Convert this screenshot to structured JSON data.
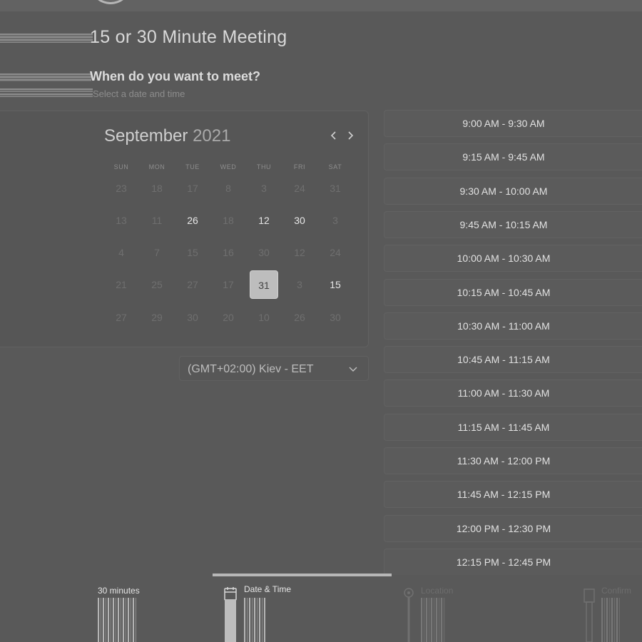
{
  "header": {
    "meeting_title": "15 or 30 Minute Meeting",
    "question": "When do you want to meet?",
    "subtitle": "Select a date and time"
  },
  "calendar": {
    "month": "September",
    "year": "2021",
    "prev_icon": "chevron-left-icon",
    "next_icon": "chevron-right-icon",
    "weekdays": [
      "SUN",
      "MON",
      "TUE",
      "WED",
      "THU",
      "FRI",
      "SAT"
    ],
    "weeks": [
      [
        {
          "d": "23",
          "a": false
        },
        {
          "d": "18",
          "a": false
        },
        {
          "d": "17",
          "a": false
        },
        {
          "d": "8",
          "a": false
        },
        {
          "d": "3",
          "a": false
        },
        {
          "d": "24",
          "a": false
        },
        {
          "d": "31",
          "a": false
        }
      ],
      [
        {
          "d": "13",
          "a": false
        },
        {
          "d": "11",
          "a": false
        },
        {
          "d": "26",
          "a": true
        },
        {
          "d": "18",
          "a": false
        },
        {
          "d": "12",
          "a": true
        },
        {
          "d": "30",
          "a": true
        },
        {
          "d": "3",
          "a": false
        }
      ],
      [
        {
          "d": "4",
          "a": false
        },
        {
          "d": "7",
          "a": false
        },
        {
          "d": "15",
          "a": false
        },
        {
          "d": "16",
          "a": false
        },
        {
          "d": "30",
          "a": false
        },
        {
          "d": "12",
          "a": false
        },
        {
          "d": "24",
          "a": false
        }
      ],
      [
        {
          "d": "21",
          "a": false
        },
        {
          "d": "25",
          "a": false
        },
        {
          "d": "27",
          "a": false
        },
        {
          "d": "17",
          "a": false
        },
        {
          "d": "31",
          "a": true,
          "selected": true
        },
        {
          "d": "3",
          "a": false
        },
        {
          "d": "15",
          "a": true
        }
      ],
      [
        {
          "d": "27",
          "a": false
        },
        {
          "d": "29",
          "a": false
        },
        {
          "d": "30",
          "a": false
        },
        {
          "d": "20",
          "a": false
        },
        {
          "d": "10",
          "a": false
        },
        {
          "d": "26",
          "a": false
        },
        {
          "d": "30",
          "a": false
        }
      ]
    ]
  },
  "timezone": {
    "value": "(GMT+02:00) Kiev - EET",
    "icon": "chevron-down-icon"
  },
  "time_slots": [
    "9:00 AM - 9:30 AM",
    "9:15 AM - 9:45 AM",
    "9:30 AM - 10:00 AM",
    "9:45 AM - 10:15 AM",
    "10:00 AM - 10:30 AM",
    "10:15 AM - 10:45 AM",
    "10:30 AM - 11:00 AM",
    "10:45 AM - 11:15 AM",
    "11:00 AM - 11:30 AM",
    "11:15 AM - 11:45 AM",
    "11:30 AM - 12:00 PM",
    "11:45 AM - 12:15 PM",
    "12:00 PM - 12:30 PM",
    "12:15 PM - 12:45 PM"
  ],
  "steps": [
    {
      "label": "30 minutes",
      "icon": "",
      "state": "done"
    },
    {
      "label": "Date & Time",
      "icon": "calendar-icon",
      "state": "active"
    },
    {
      "label": "Location",
      "icon": "location-pin-icon",
      "state": "pending"
    },
    {
      "label": "Confirm",
      "icon": "document-icon",
      "state": "pending"
    }
  ],
  "colors": {
    "background": "#595959",
    "selected_day": "#bdbdbd",
    "progress": "#b7b7b7"
  }
}
